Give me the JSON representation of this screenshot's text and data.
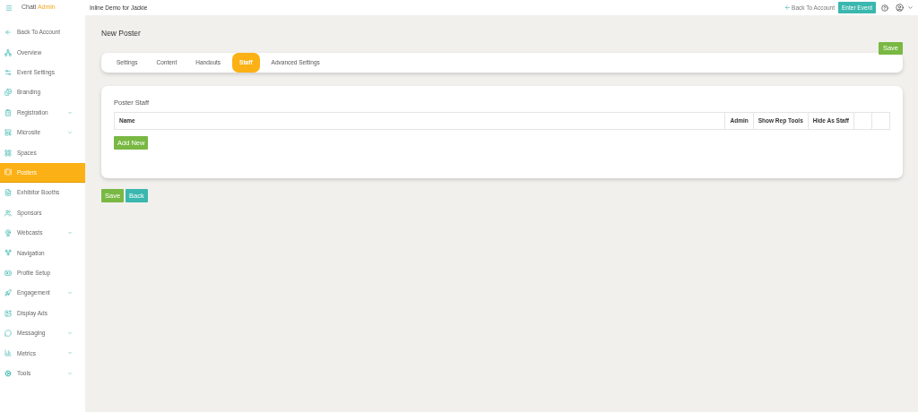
{
  "brand": {
    "name": "Chati",
    "suffix": "Admin"
  },
  "header": {
    "title": "Inline Demo for Jackie",
    "back_link": "Back To Account",
    "enter_button": "Enter Event"
  },
  "sidebar": {
    "items": [
      {
        "label": "Back To Account",
        "selected": false,
        "expandable": false
      },
      {
        "label": "Overview",
        "selected": false,
        "expandable": false
      },
      {
        "label": "Event Settings",
        "selected": false,
        "expandable": false
      },
      {
        "label": "Branding",
        "selected": false,
        "expandable": false
      },
      {
        "label": "Registration",
        "selected": false,
        "expandable": true
      },
      {
        "label": "Microsite",
        "selected": false,
        "expandable": true
      },
      {
        "label": "Spaces",
        "selected": false,
        "expandable": false
      },
      {
        "label": "Posters",
        "selected": true,
        "expandable": false
      },
      {
        "label": "Exhibitor Booths",
        "selected": false,
        "expandable": false
      },
      {
        "label": "Sponsors",
        "selected": false,
        "expandable": false
      },
      {
        "label": "Webcasts",
        "selected": false,
        "expandable": true
      },
      {
        "label": "Navigation",
        "selected": false,
        "expandable": false
      },
      {
        "label": "Profile Setup",
        "selected": false,
        "expandable": false
      },
      {
        "label": "Engagement",
        "selected": false,
        "expandable": true
      },
      {
        "label": "Display Ads",
        "selected": false,
        "expandable": false
      },
      {
        "label": "Messaging",
        "selected": false,
        "expandable": true
      },
      {
        "label": "Metrics",
        "selected": false,
        "expandable": true
      },
      {
        "label": "Tools",
        "selected": false,
        "expandable": true
      }
    ]
  },
  "page": {
    "title": "New Poster",
    "save_button": "Save"
  },
  "tabs": [
    {
      "label": "Settings",
      "selected": false
    },
    {
      "label": "Content",
      "selected": false
    },
    {
      "label": "Handouts",
      "selected": false
    },
    {
      "label": "Staff",
      "selected": true
    },
    {
      "label": "Advanced Settings",
      "selected": false
    }
  ],
  "panel": {
    "title": "Poster Staff",
    "table": {
      "columns": [
        "Name",
        "Admin",
        "Show Rep Tools",
        "Hide As Staff"
      ]
    },
    "add_button": "Add New"
  },
  "footer_buttons": [
    {
      "label": "Save",
      "kind": "primary"
    },
    {
      "label": "Back",
      "kind": "secondary"
    }
  ]
}
